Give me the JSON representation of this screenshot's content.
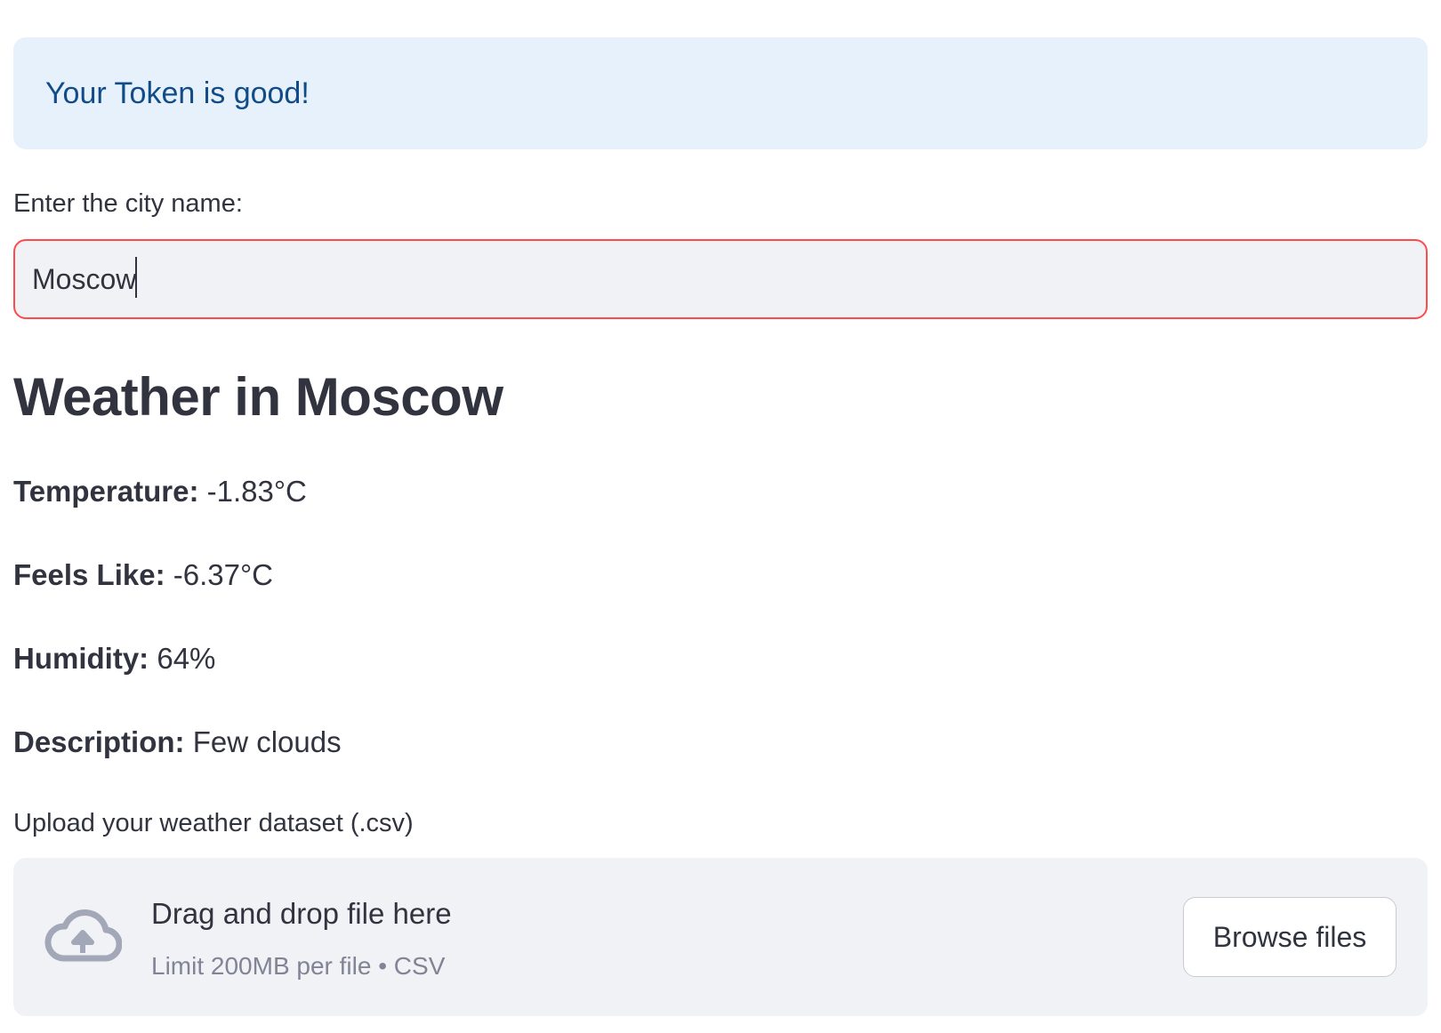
{
  "alert": {
    "message": "Your Token is good!",
    "background": "#e7f1fb",
    "text_color": "#114b88"
  },
  "city_input": {
    "label": "Enter the city name:",
    "value": "Moscow",
    "border_color": "#ff4b4b"
  },
  "weather": {
    "heading": "Weather in Moscow",
    "stats": [
      {
        "label": "Temperature:",
        "value": "-1.83°C"
      },
      {
        "label": "Feels Like:",
        "value": "-6.37°C"
      },
      {
        "label": "Humidity:",
        "value": "64%"
      },
      {
        "label": "Description:",
        "value": "Few clouds"
      }
    ]
  },
  "uploader": {
    "label": "Upload your weather dataset (.csv)",
    "drop_title": "Drag and drop file here",
    "drop_subtitle": "Limit 200MB per file • CSV",
    "browse_label": "Browse files",
    "icon": "cloud-upload-icon"
  }
}
